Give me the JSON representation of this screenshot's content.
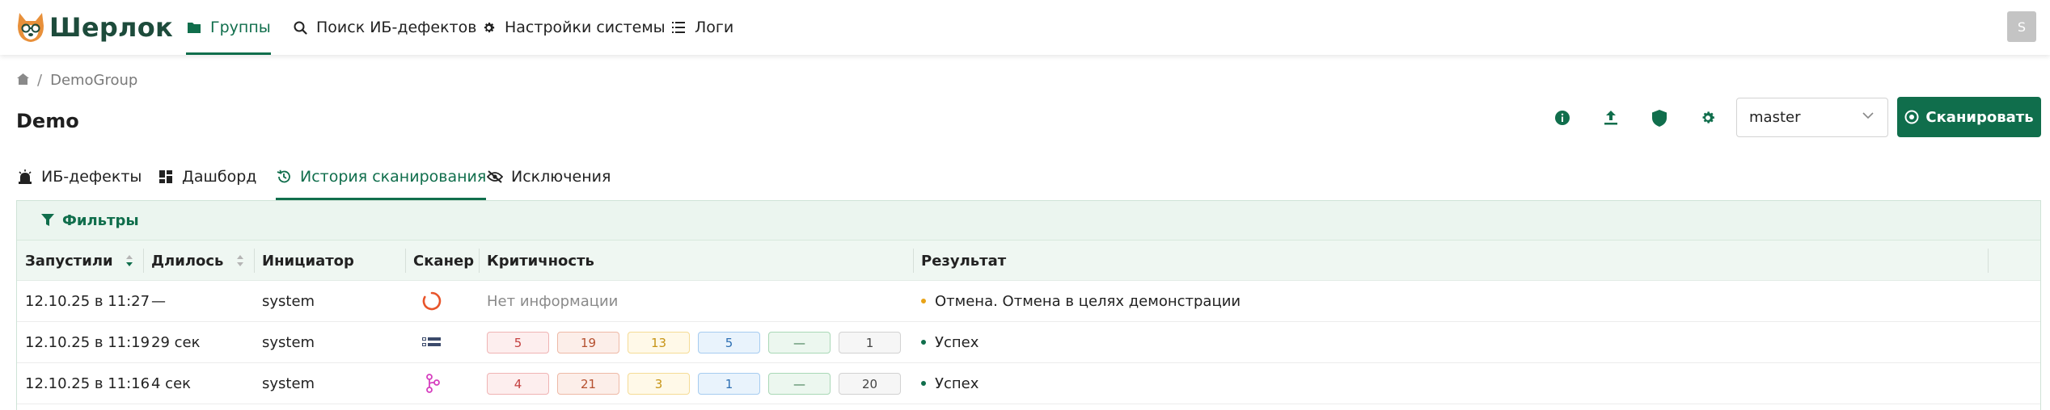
{
  "app": {
    "name": "Шерлок",
    "avatar_letter": "S"
  },
  "nav": {
    "groups": "Группы",
    "search": "Поиск ИБ-дефектов",
    "settings": "Настройки системы",
    "logs": "Логи"
  },
  "breadcrumb": {
    "current": "DemoGroup"
  },
  "page": {
    "title": "Demo"
  },
  "toolbar": {
    "icons": [
      "info-icon",
      "upload-icon",
      "shield-icon",
      "gear-icon"
    ],
    "branch": "master",
    "scan_label": "Сканировать"
  },
  "tabs": {
    "defects": "ИБ-дефекты",
    "dashboard": "Дашборд",
    "history": "История сканирования",
    "exclusions": "Исключения"
  },
  "filters": {
    "label": "Фильтры"
  },
  "table": {
    "columns": {
      "started": "Запустили",
      "duration": "Длилось",
      "initiator": "Инициатор",
      "scanner": "Сканер",
      "severity": "Критичность",
      "result": "Результат"
    },
    "rows": [
      {
        "started": "12.10.25 в 11:27",
        "duration": "—",
        "initiator": "system",
        "scanner_icon": "spinner-icon",
        "no_info": "Нет информации",
        "severity": [
          "",
          "",
          "",
          "",
          "",
          ""
        ],
        "result": "Отмена. Отмена в целях демонстрации",
        "result_color": "#e8a317"
      },
      {
        "started": "12.10.25 в 11:19",
        "duration": "29 сек",
        "initiator": "system",
        "scanner_icon": "scanner-list-icon",
        "no_info": "",
        "severity": [
          "5",
          "19",
          "13",
          "5",
          "—",
          "1"
        ],
        "result": "Успех",
        "result_color": "#106e4c"
      },
      {
        "started": "12.10.25 в 11:16",
        "duration": "4 сек",
        "initiator": "system",
        "scanner_icon": "scanner-branch-icon",
        "no_info": "",
        "severity": [
          "4",
          "21",
          "3",
          "1",
          "—",
          "20"
        ],
        "result": "Успех",
        "result_color": "#106e4c"
      }
    ]
  },
  "colors": {
    "accent": "#106e4c",
    "warning": "#e8a317"
  }
}
